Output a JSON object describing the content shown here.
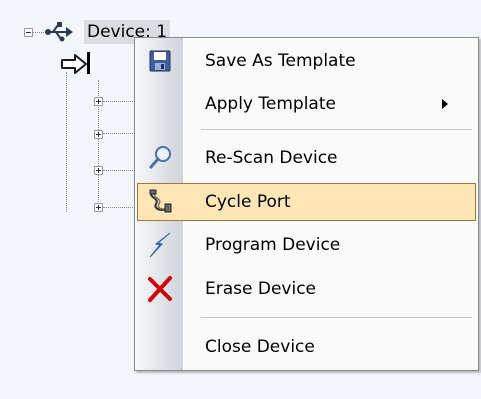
{
  "tree": {
    "device_label": "Device: 1"
  },
  "context_menu": {
    "items": [
      {
        "label": "Save As Template",
        "icon": "floppy-disk-icon"
      },
      {
        "label": "Apply Template",
        "icon": "",
        "has_submenu": true
      },
      {
        "label": "Re-Scan Device",
        "icon": "magnifier-icon"
      },
      {
        "label": "Cycle Port",
        "icon": "cable-icon",
        "highlighted": true
      },
      {
        "label": "Program Device",
        "icon": "lightning-icon"
      },
      {
        "label": "Erase Device",
        "icon": "red-x-icon"
      },
      {
        "label": "Close Device",
        "icon": ""
      }
    ],
    "colors": {
      "highlight_fill": "#ffe6b6",
      "highlight_border": "#a07a3a",
      "erase_red": "#cc0000"
    }
  }
}
